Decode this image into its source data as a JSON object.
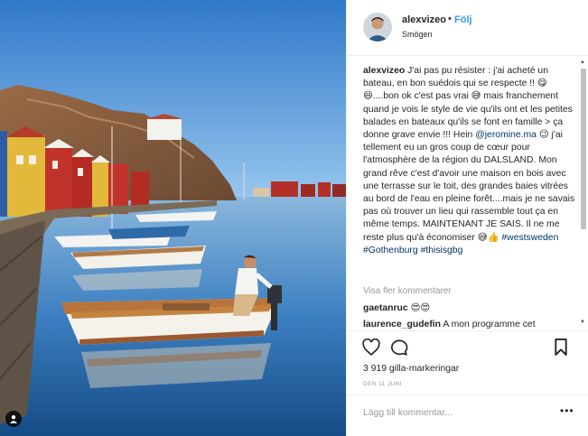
{
  "header": {
    "username": "alexvizeo",
    "separator": "•",
    "follow_label": "Följ",
    "location": "Smögen"
  },
  "caption": {
    "username": "alexvizeo",
    "part1": "J'ai pas pu résister : j'ai acheté un bateau, en bon suédois qui se respecte !! 😋😄....bon ok c'est pas vrai 😅 mais franchement quand je vois le style de vie qu'ils ont et les petites balades en bateaux qu'ils se font en famille > ça donne grave envie !!! Hein",
    "mention": "@jeromine.ma",
    "part2": "😉 j'ai tellement eu un gros coup de cœur pour l'atmosphère de la région du DALSLAND. Mon grand rêve c'est d'avoir une maison en bois avec une terrasse sur le toit, des grandes baies vitrées au bord de l'eau en pleine forêt....mais je ne savais pas où trouver un lieu qui rassemble tout ça en même temps. MAINTENANT JE SAIS. Il ne me reste plus qu'à économiser 😅👍",
    "hashtag1": "#westsweden",
    "hashtag2": "#Gothenburg",
    "hashtag3": "#thisisgbg"
  },
  "comments": {
    "view_more": "Visa fler kommentarer",
    "items": [
      {
        "username": "gaetanruc",
        "text": "😍😍"
      },
      {
        "username": "laurence_gudefin",
        "text": "A mon programme cet"
      }
    ]
  },
  "actions": {
    "like_icon": "heart-outline-icon",
    "comment_icon": "comment-bubble-icon",
    "save_icon": "bookmark-outline-icon"
  },
  "likes_text": "3 919 gilla-markeringar",
  "date": "DEN 11 JUNI",
  "add_comment": {
    "placeholder": "Lägg till kommentar...",
    "more_label": "•••"
  },
  "colors": {
    "accent": "#3897f0",
    "link": "#003569",
    "muted": "#999999",
    "text": "#262626",
    "border": "#efefef"
  }
}
